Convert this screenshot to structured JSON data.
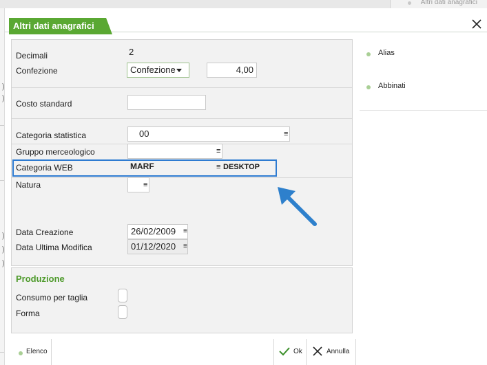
{
  "background_window": {
    "tab_label": "Altri dati anagrafici"
  },
  "dialog": {
    "title": "Altri dati anagrafici",
    "accent_color": "#5aa832",
    "highlight_color": "#2e7bd1"
  },
  "fields": {
    "decimali": {
      "label": "Decimali",
      "value": "2"
    },
    "confezione": {
      "label": "Confezione",
      "select_value": "Confezione",
      "quantity": "4,00"
    },
    "costo_standard": {
      "label": "Costo standard",
      "value": ""
    },
    "categoria_statistica": {
      "label": "Categoria statistica",
      "value": "00"
    },
    "gruppo_merceologico": {
      "label": "Gruppo merceologico",
      "value": ""
    },
    "categoria_web": {
      "label": "Categoria WEB",
      "value": "MARF",
      "description": "DESKTOP"
    },
    "natura": {
      "label": "Natura",
      "value": ""
    },
    "data_creazione": {
      "label": "Data Creazione",
      "value": "26/02/2009"
    },
    "data_ultima_modifica": {
      "label": "Data Ultima Modifica",
      "value": "01/12/2020"
    }
  },
  "produzione": {
    "title": "Produzione",
    "consumo_label": "Consumo per taglia",
    "forma_label": "Forma"
  },
  "side_panel": {
    "items": [
      {
        "label": "Alias"
      },
      {
        "label": "Abbinati"
      }
    ]
  },
  "bottom_bar": {
    "elenco_label": "Elenco",
    "ok_label": "Ok",
    "annulla_label": "Annulla"
  },
  "icons": {
    "close": "close-icon",
    "menu": "menu-lines-icon",
    "ok": "check-icon",
    "annulla": "x-icon",
    "pointer": "arrow-icon"
  }
}
